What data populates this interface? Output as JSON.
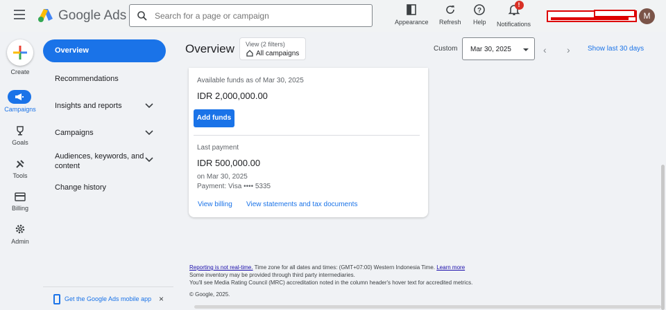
{
  "header": {
    "brand": "Google Ads",
    "search_placeholder": "Search for a page or campaign",
    "tools": [
      {
        "name": "Appearance",
        "icon": "appearance-icon"
      },
      {
        "name": "Refresh",
        "icon": "refresh-icon"
      },
      {
        "name": "Help",
        "icon": "help-icon"
      },
      {
        "name": "Notifications",
        "icon": "bell-icon",
        "badge": "!"
      }
    ],
    "avatar_initial": "M"
  },
  "rail": {
    "create": "Create",
    "items": [
      {
        "label": "Campaigns",
        "icon": "megaphone-icon",
        "active": true
      },
      {
        "label": "Goals",
        "icon": "trophy-icon"
      },
      {
        "label": "Tools",
        "icon": "tools-icon"
      },
      {
        "label": "Billing",
        "icon": "credit-card-icon"
      },
      {
        "label": "Admin",
        "icon": "gear-icon"
      }
    ]
  },
  "sidenav": {
    "overview": "Overview",
    "items": [
      {
        "label": "Recommendations",
        "expandable": false
      },
      {
        "label": "Insights and reports",
        "expandable": true
      },
      {
        "label": "Campaigns",
        "expandable": true
      },
      {
        "label": "Audiences, keywords, and content",
        "expandable": true
      },
      {
        "label": "Change history",
        "expandable": false
      }
    ],
    "app_banner": "Get the Google Ads mobile app",
    "close": "×"
  },
  "toolbar": {
    "title": "Overview",
    "view_filters": "View (2 filters)",
    "view_scope": "All campaigns",
    "custom": "Custom",
    "date": "Mar 30, 2025",
    "show_last": "Show last 30 days"
  },
  "billing_card": {
    "available_label": "Available funds as of Mar 30, 2025",
    "available_amount": "IDR 2,000,000.00",
    "add_funds": "Add funds",
    "last_payment_label": "Last payment",
    "last_payment_amount": "IDR 500,000.00",
    "payment_date": "on Mar 30, 2025",
    "payment_method": "Payment: Visa •••• 5335",
    "view_billing": "View billing",
    "view_statements": "View statements and tax documents"
  },
  "footer": {
    "realtime_link": "Reporting is not real-time.",
    "timezone": " Time zone for all dates and times: (GMT+07:00) Western Indonesia Time. ",
    "learn_more": "Learn more",
    "inventory": "Some inventory may be provided through third party intermediaries.",
    "mrc": "You'll see Media Rating Council (MRC) accreditation noted in the column header's hover text for accredited metrics.",
    "copyright": "© Google, 2025."
  },
  "colors": {
    "accent": "#1a73e8",
    "background": "#f0f2f5",
    "redaction": "#dd0000"
  }
}
